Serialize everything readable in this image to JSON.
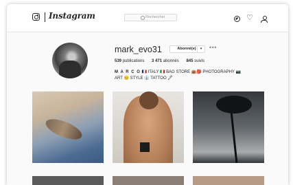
{
  "app": {
    "name": "Instagram",
    "search_placeholder": "Rechercher"
  },
  "icons": {
    "logo": "instagram-camera-icon",
    "search": "search-icon",
    "explore": "compass-icon",
    "activity": "heart-icon",
    "profile": "person-icon",
    "more": "ellipsis-icon"
  },
  "profile": {
    "username": "mark_evo31",
    "follow_label": "Abonné(e)",
    "dropdown_glyph": "▾",
    "more_glyph": "•••",
    "stats": {
      "posts": "539",
      "posts_label": "publications",
      "followers": "3 471",
      "followers_label": "abonnés",
      "following": "845",
      "following_label": "suivis"
    },
    "bio_name": "M A R C O",
    "bio_text": "🇫🇷 ITALY 🇮🇹 BAG STORE 👜🎒 PHOTOGRAPHY 📷 ART 😊 STYLE 👔 TATTOO 🖋"
  },
  "colors": {
    "background": "#fafafa",
    "border": "#dbdbdb",
    "text": "#262626"
  }
}
